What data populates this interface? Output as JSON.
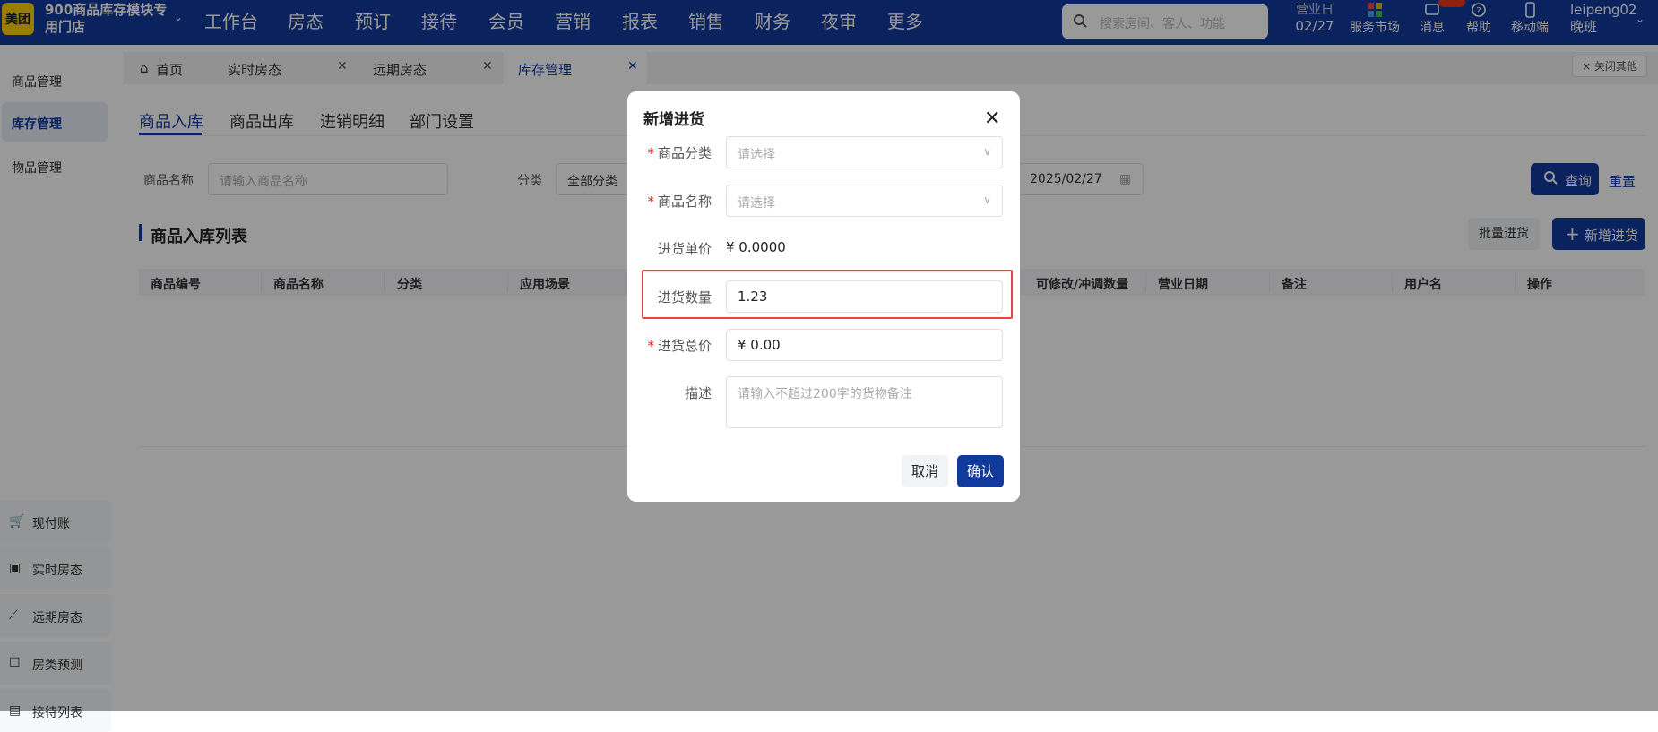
{
  "app": {
    "logo_text": "美团",
    "store_name": "900商品库存模块专用门店",
    "menu": [
      "工作台",
      "房态",
      "预订",
      "接待",
      "会员",
      "营销",
      "报表",
      "销售",
      "财务",
      "夜审",
      "更多"
    ],
    "search_placeholder": "搜索房间、客人、功能",
    "business_day_label": "营业日",
    "business_day_value": "02/27",
    "tools": [
      "服务市场",
      "消息",
      "帮助",
      "移动端"
    ],
    "user_name": "leipeng02",
    "user_shift": "晚班"
  },
  "sidebar": {
    "items": [
      "商品管理",
      "库存管理",
      "物品管理"
    ],
    "active": "库存管理",
    "quick_links": [
      {
        "icon": "cart-icon",
        "label": "现付账"
      },
      {
        "icon": "room-status-icon",
        "label": "实时房态"
      },
      {
        "icon": "trend-icon",
        "label": "远期房态"
      },
      {
        "icon": "forecast-icon",
        "label": "房类预测"
      },
      {
        "icon": "reception-icon",
        "label": "接待列表"
      }
    ]
  },
  "tabs": {
    "items": [
      "首页",
      "实时房态",
      "远期房态",
      "库存管理"
    ],
    "active": "库存管理",
    "close_others": "× 关闭其他"
  },
  "subtabs": {
    "items": [
      "商品入库",
      "商品出库",
      "进销明细",
      "部门设置"
    ],
    "active": "商品入库"
  },
  "filters": {
    "name_label": "商品名称",
    "name_placeholder": "请输入商品名称",
    "category_label": "分类",
    "category_value": "全部分类",
    "date_value": "2025/02/27",
    "query_button": "查询",
    "reset_button": "重置"
  },
  "list": {
    "title": "商品入库列表",
    "batch_button": "批量进货",
    "add_button": "新增进货",
    "columns": [
      "商品编号",
      "商品名称",
      "分类",
      "应用场景",
      "可修改/冲调数量",
      "营业日期",
      "备注",
      "用户名",
      "操作"
    ]
  },
  "modal": {
    "title": "新增进货",
    "fields": {
      "category_label": "商品分类",
      "category_placeholder": "请选择",
      "name_label": "商品名称",
      "name_placeholder": "请选择",
      "unit_price_label": "进货单价",
      "unit_price_value": "¥ 0.0000",
      "quantity_label": "进货数量",
      "quantity_value": "1.23",
      "total_label": "进货总价",
      "total_value": "¥ 0.00",
      "desc_label": "描述",
      "desc_placeholder": "请输入不超过200字的货物备注"
    },
    "cancel_button": "取消",
    "ok_button": "确认"
  },
  "colors": {
    "brand": "#123a9c",
    "logo": "#ffd100",
    "required": "#e2231a",
    "highlight": "#e64545"
  }
}
